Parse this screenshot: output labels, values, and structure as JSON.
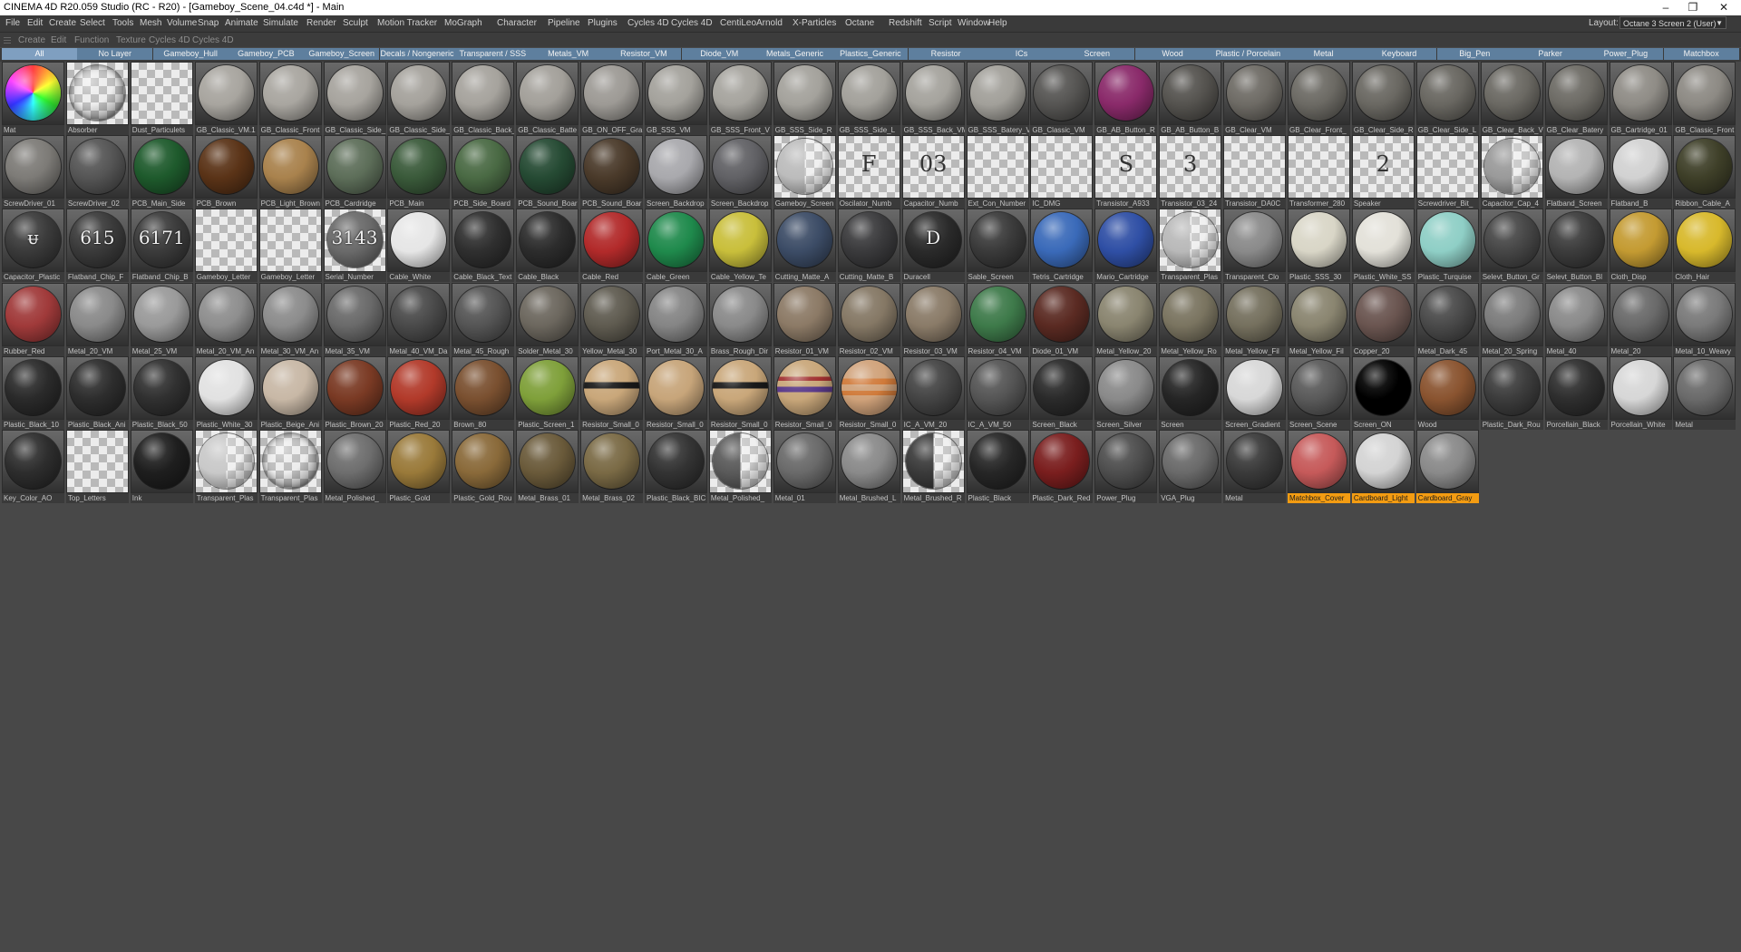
{
  "window": {
    "title": "CINEMA 4D R20.059 Studio (RC - R20) - [Gameboy_Scene_04.c4d *] - Main",
    "minimize_glyph": "–",
    "maximize_glyph": "❐",
    "close_glyph": "✕"
  },
  "menubar": {
    "items": [
      "File",
      "Edit",
      "Create",
      "Select",
      "Tools",
      "Mesh",
      "Volume",
      "Snap",
      "Animate",
      "Simulate",
      "Render",
      "Sculpt",
      "Motion Tracker",
      "MoGraph",
      "Character",
      "Pipeline",
      "Plugins",
      "Cycles 4D",
      "Cycles 4D",
      "CentiLeo",
      "Arnold",
      "X-Particles",
      "Octane",
      "Redshift",
      "Script",
      "Window",
      "Help"
    ],
    "layout_label": "Layout:",
    "layout_value": "Octane 3 Screen 2 (User)"
  },
  "material_menu": {
    "items": [
      "Create",
      "Edit",
      "Function",
      "Texture",
      "Cycles 4D",
      "Cycles 4D"
    ]
  },
  "layer_tabs": [
    "All",
    "No Layer",
    "Gameboy_Hull",
    "Gameboy_PCB",
    "Gameboy_Screen",
    "Decals / Nongeneric",
    "Transparent / SSS",
    "Metals_VM",
    "Resistor_VM",
    "Diode_VM",
    "Metals_Generic",
    "Plastics_Generic",
    "Resistor",
    "ICs",
    "Screen",
    "Wood",
    "Plastic / Porcelain",
    "Metal",
    "Keyboard",
    "Big_Pen",
    "Parker",
    "Power_Plug",
    "Matchbox"
  ],
  "layer_tab_colors": [
    "#7f9fc0",
    "#5e7f9e",
    "#5e7f9e",
    "#5e7f9e",
    "#5e7f9e",
    "#5e7f9e",
    "#5e7f9e",
    "#5e7f9e",
    "#5e7f9e",
    "#5e7f9e",
    "#5e7f9e",
    "#5e7f9e",
    "#5e7f9e",
    "#5e7f9e",
    "#5e7f9e",
    "#5e7f9e",
    "#5e7f9e",
    "#5e7f9e",
    "#5e7f9e",
    "#5e7f9e",
    "#5e7f9e",
    "#5e7f9e",
    "#5e7f9e"
  ],
  "materials": [
    {
      "name": "Mat",
      "bg": "dark",
      "kind": "rainbow"
    },
    {
      "name": "Absorber",
      "bg": "checker",
      "kind": "clear"
    },
    {
      "name": "Dust_Particulets",
      "bg": "checker",
      "kind": "none"
    },
    {
      "name": "GB_Classic_VM.1",
      "bg": "dark",
      "color": "#a8a59f"
    },
    {
      "name": "GB_Classic_Front",
      "bg": "dark",
      "color": "#a9a6a0"
    },
    {
      "name": "GB_Classic_Side_",
      "bg": "dark",
      "color": "#a7a49e"
    },
    {
      "name": "GB_Classic_Side_",
      "bg": "dark",
      "color": "#a5a29c"
    },
    {
      "name": "GB_Classic_Back_",
      "bg": "dark",
      "color": "#a6a39d"
    },
    {
      "name": "GB_Classic_Batte",
      "bg": "dark",
      "color": "#a3a09a"
    },
    {
      "name": "GB_ON_OFF_Gra",
      "bg": "dark",
      "color": "#9d9a95"
    },
    {
      "name": "GB_SSS_VM",
      "bg": "dark",
      "color": "#a4a29c"
    },
    {
      "name": "GB_SSS_Front_V",
      "bg": "dark",
      "color": "#a6a49e"
    },
    {
      "name": "GB_SSS_Side_R",
      "bg": "dark",
      "color": "#a4a29c"
    },
    {
      "name": "GB_SSS_Side_L",
      "bg": "dark",
      "color": "#a3a19b"
    },
    {
      "name": "GB_SSS_Back_VM",
      "bg": "dark",
      "color": "#a5a39d"
    },
    {
      "name": "GB_SSS_Batery_V",
      "bg": "dark",
      "color": "#a2a09a"
    },
    {
      "name": "GB_Classic_VM",
      "bg": "dark",
      "color": "#565553"
    },
    {
      "name": "GB_AB_Button_R",
      "bg": "dark",
      "color": "#8a2a6a"
    },
    {
      "name": "GB_AB_Button_B",
      "bg": "dark",
      "color": "#55534f"
    },
    {
      "name": "GB_Clear_VM",
      "bg": "dark",
      "color": "#6e6b65"
    },
    {
      "name": "GB_Clear_Front_",
      "bg": "dark",
      "color": "#6c6a64"
    },
    {
      "name": "GB_Clear_Side_R",
      "bg": "dark",
      "color": "#6a6862"
    },
    {
      "name": "GB_Clear_Side_L",
      "bg": "dark",
      "color": "#696761"
    },
    {
      "name": "GB_Clear_Back_V",
      "bg": "dark",
      "color": "#6b6963"
    },
    {
      "name": "GB_Clear_Batery",
      "bg": "dark",
      "color": "#6d6b65"
    },
    {
      "name": "GB_Cartridge_01",
      "bg": "dark",
      "color": "#8f8c86"
    },
    {
      "name": "GB_Classic_Front",
      "bg": "dark",
      "color": "#8d8a84"
    },
    {
      "name": "ScrewDriver_01",
      "bg": "dark",
      "color": "#7d7b77"
    },
    {
      "name": "ScrewDriver_02",
      "bg": "dark",
      "color": "#555555"
    },
    {
      "name": "PCB_Main_Side",
      "bg": "dark",
      "color": "#1e5a2c"
    },
    {
      "name": "PCB_Brown",
      "bg": "dark",
      "color": "#5a3317"
    },
    {
      "name": "PCB_Light_Brown",
      "bg": "dark",
      "color": "#a9824d"
    },
    {
      "name": "PCB_Cardridge",
      "bg": "dark",
      "color": "#5d6e59"
    },
    {
      "name": "PCB_Main",
      "bg": "dark",
      "color": "#3a5a3a"
    },
    {
      "name": "PCB_Side_Board",
      "bg": "dark",
      "color": "#4a6a44"
    },
    {
      "name": "PCB_Sound_Boar",
      "bg": "dark",
      "color": "#254a33"
    },
    {
      "name": "PCB_Sound_Boar",
      "bg": "dark",
      "color": "#4a3a2a"
    },
    {
      "name": "Screen_Backdrop",
      "bg": "dark",
      "color": "#a9a9ad"
    },
    {
      "name": "Screen_Backdrop",
      "bg": "dark",
      "color": "#616165"
    },
    {
      "name": "Gameboy_Screen",
      "bg": "checker",
      "color": "#bcbcbc",
      "kind": "half"
    },
    {
      "name": "Oscilator_Numb",
      "bg": "checker",
      "kind": "none",
      "text": "F"
    },
    {
      "name": "Capacitor_Numb",
      "bg": "checker",
      "kind": "none",
      "text": "03"
    },
    {
      "name": "Ext_Con_Number",
      "bg": "checker",
      "kind": "none"
    },
    {
      "name": "IC_DMG",
      "bg": "checker",
      "kind": "none"
    },
    {
      "name": "Transistor_A933",
      "bg": "checker",
      "kind": "none",
      "text": "S"
    },
    {
      "name": "Transistor_03_24",
      "bg": "checker",
      "kind": "none",
      "text": "3"
    },
    {
      "name": "Transistor_DA0C",
      "bg": "checker",
      "kind": "none"
    },
    {
      "name": "Transformer_280",
      "bg": "checker",
      "kind": "none"
    },
    {
      "name": "Speaker",
      "bg": "checker",
      "kind": "none",
      "text": "2"
    },
    {
      "name": "Screwdriver_Bit_",
      "bg": "checker",
      "kind": "none"
    },
    {
      "name": "Capacitor_Cap_4",
      "bg": "checker",
      "color": "#9a9a9a",
      "kind": "half"
    },
    {
      "name": "Flatband_Screen",
      "bg": "dark",
      "color": "#b4b4b4"
    },
    {
      "name": "Flatband_B",
      "bg": "dark",
      "color": "#d2d2d2"
    },
    {
      "name": "Ribbon_Cable_A",
      "bg": "dark",
      "color": "#3e3f28"
    },
    {
      "name": "Capacitor_Plastic",
      "bg": "dark",
      "color": "#3a3a3a",
      "text": "ᵾ"
    },
    {
      "name": "Flatband_Chip_F",
      "bg": "dark",
      "color": "#3a3a3a",
      "text": "615"
    },
    {
      "name": "Flatband_Chip_B",
      "bg": "dark",
      "color": "#3b3b3b",
      "text": "6171"
    },
    {
      "name": "Gameboy_Letter",
      "bg": "checker",
      "kind": "none"
    },
    {
      "name": "Gameboy_Letter",
      "bg": "checker",
      "kind": "none"
    },
    {
      "name": "Serial_Number",
      "bg": "checker",
      "color": "#6a6a6a",
      "text": "3143"
    },
    {
      "name": "Cable_White",
      "bg": "dark",
      "color": "#e6e6e6"
    },
    {
      "name": "Cable_Black_Text",
      "bg": "dark",
      "color": "#2f2f2f"
    },
    {
      "name": "Cable_Black",
      "bg": "dark",
      "color": "#2c2c2c"
    },
    {
      "name": "Cable_Red",
      "bg": "dark",
      "color": "#b22a2a"
    },
    {
      "name": "Cable_Green",
      "bg": "dark",
      "color": "#1f8a4c"
    },
    {
      "name": "Cable_Yellow_Te",
      "bg": "dark",
      "color": "#c9bf3b"
    },
    {
      "name": "Cutting_Matte_A",
      "bg": "dark",
      "color": "#3c4c66"
    },
    {
      "name": "Cutting_Matte_B",
      "bg": "dark",
      "color": "#3a3a3c"
    },
    {
      "name": "Duracell",
      "bg": "dark",
      "color": "#2a2a2a",
      "text": "D"
    },
    {
      "name": "Sable_Screen",
      "bg": "dark",
      "color": "#3a3a3a"
    },
    {
      "name": "Tetris_Cartridge",
      "bg": "dark",
      "color": "#3a6ab9"
    },
    {
      "name": "Mario_Cartridge",
      "bg": "dark",
      "color": "#2f4fa5"
    },
    {
      "name": "Transparent_Plas",
      "bg": "checker",
      "color": "#b9b9b9",
      "kind": "half"
    },
    {
      "name": "Transparent_Clo",
      "bg": "dark",
      "color": "#8a8a8a"
    },
    {
      "name": "Plastic_SSS_30",
      "bg": "dark",
      "color": "#d9d6c7"
    },
    {
      "name": "Plastic_White_SS",
      "bg": "dark",
      "color": "#e3e1d9"
    },
    {
      "name": "Plastic_Turquise",
      "bg": "dark",
      "color": "#8fcfc6"
    },
    {
      "name": "Selevt_Button_Gr",
      "bg": "dark",
      "color": "#464646"
    },
    {
      "name": "Selevt_Button_Bl",
      "bg": "dark",
      "color": "#3c3c3c"
    },
    {
      "name": "Cloth_Disp",
      "bg": "dark",
      "color": "#c49b32"
    },
    {
      "name": "Cloth_Hair",
      "bg": "dark",
      "color": "#d8b92c"
    },
    {
      "name": "Rubber_Red",
      "bg": "dark",
      "color": "#a03a3a"
    },
    {
      "name": "Metal_20_VM",
      "bg": "dark",
      "color": "#8a8a8a"
    },
    {
      "name": "Metal_25_VM",
      "bg": "dark",
      "color": "#9a9a9a"
    },
    {
      "name": "Metal_20_VM_An",
      "bg": "dark",
      "color": "#8e8e8e"
    },
    {
      "name": "Metal_30_VM_An",
      "bg": "dark",
      "color": "#8c8c8c"
    },
    {
      "name": "Metal_35_VM",
      "bg": "dark",
      "color": "#6a6a6a"
    },
    {
      "name": "Metal_40_VM_Da",
      "bg": "dark",
      "color": "#4a4a4a"
    },
    {
      "name": "Metal_45_Rough",
      "bg": "dark",
      "color": "#555555"
    },
    {
      "name": "Solder_Metal_30",
      "bg": "dark",
      "color": "#6c675e"
    },
    {
      "name": "Yellow_Metal_30",
      "bg": "dark",
      "color": "#5f5b50"
    },
    {
      "name": "Port_Metal_30_A",
      "bg": "dark",
      "color": "#858585"
    },
    {
      "name": "Brass_Rough_Dir",
      "bg": "dark",
      "color": "#8a8a8a"
    },
    {
      "name": "Resistor_01_VM",
      "bg": "dark",
      "color": "#8c7a66"
    },
    {
      "name": "Resistor_02_VM",
      "bg": "dark",
      "color": "#857865"
    },
    {
      "name": "Resistor_03_VM",
      "bg": "dark",
      "color": "#8a7b68"
    },
    {
      "name": "Resistor_04_VM",
      "bg": "dark",
      "color": "#3e7a4a"
    },
    {
      "name": "Diode_01_VM",
      "bg": "dark",
      "color": "#5a2a22"
    },
    {
      "name": "Metal_Yellow_20",
      "bg": "dark",
      "color": "#8a8570"
    },
    {
      "name": "Metal_Yellow_Ro",
      "bg": "dark",
      "color": "#7a7460"
    },
    {
      "name": "Metal_Yellow_Fil",
      "bg": "dark",
      "color": "#75705e"
    },
    {
      "name": "Metal_Yellow_Fil",
      "bg": "dark",
      "color": "#8a8570"
    },
    {
      "name": "Copper_20",
      "bg": "dark",
      "color": "#6a5550"
    },
    {
      "name": "Metal_Dark_45",
      "bg": "dark",
      "color": "#4a4a4a"
    },
    {
      "name": "Metal_20_Spring",
      "bg": "dark",
      "color": "#7c7c7c"
    },
    {
      "name": "Metal_40",
      "bg": "dark",
      "color": "#8a8a8a"
    },
    {
      "name": "Metal_20",
      "bg": "dark",
      "color": "#6a6a6a"
    },
    {
      "name": "Metal_10_Weavy",
      "bg": "dark",
      "color": "#7a7a7a"
    },
    {
      "name": "Plastic_Black_10",
      "bg": "dark",
      "color": "#2a2a2a"
    },
    {
      "name": "Plastic_Black_Ani",
      "bg": "dark",
      "color": "#2d2d2d"
    },
    {
      "name": "Plastic_Black_50",
      "bg": "dark",
      "color": "#303030"
    },
    {
      "name": "Plastic_White_30",
      "bg": "dark",
      "color": "#e2e2e2"
    },
    {
      "name": "Plastic_Beige_Ani",
      "bg": "dark",
      "color": "#c8b8a6"
    },
    {
      "name": "Plastic_Brown_20",
      "bg": "dark",
      "color": "#7a3a24"
    },
    {
      "name": "Plastic_Red_20",
      "bg": "dark",
      "color": "#b23a2a"
    },
    {
      "name": "Brown_80",
      "bg": "dark",
      "color": "#7a5030"
    },
    {
      "name": "Plastic_Screen_1",
      "bg": "dark",
      "color": "#7fa03a"
    },
    {
      "name": "Resistor_Small_0",
      "bg": "dark",
      "color": "#c9a77a",
      "kind": "stripe"
    },
    {
      "name": "Resistor_Small_0",
      "bg": "dark",
      "color": "#c7a57a"
    },
    {
      "name": "Resistor_Small_0",
      "bg": "dark",
      "color": "#c9a77a",
      "kind": "stripe"
    },
    {
      "name": "Resistor_Small_0",
      "bg": "dark",
      "color": "#c9a77a",
      "kind": "stripe2"
    },
    {
      "name": "Resistor_Small_0",
      "bg": "dark",
      "color": "#d0a27a",
      "kind": "stripe3"
    },
    {
      "name": "IC_A_VM_20",
      "bg": "dark",
      "color": "#444444"
    },
    {
      "name": "IC_A_VM_50",
      "bg": "dark",
      "color": "#555555"
    },
    {
      "name": "Screen_Black",
      "bg": "dark",
      "color": "#2a2a2a"
    },
    {
      "name": "Screen_Silver",
      "bg": "dark",
      "color": "#8a8a8a"
    },
    {
      "name": "Screen",
      "bg": "dark",
      "color": "#252525"
    },
    {
      "name": "Screen_Gradient",
      "bg": "dark",
      "color": "#d8d8d8"
    },
    {
      "name": "Screen_Scene",
      "bg": "dark",
      "color": "#5a5a5a"
    },
    {
      "name": "Screen_ON",
      "bg": "dark",
      "color": "#000000"
    },
    {
      "name": "Wood",
      "bg": "dark",
      "color": "#8a5430"
    },
    {
      "name": "Plastic_Dark_Rou",
      "bg": "dark",
      "color": "#3c3c3c"
    },
    {
      "name": "Porcellain_Black",
      "bg": "dark",
      "color": "#2e2e2e"
    },
    {
      "name": "Porcellain_White",
      "bg": "dark",
      "color": "#d7d7d7"
    },
    {
      "name": "Metal",
      "bg": "dark",
      "color": "#6a6a6a"
    },
    {
      "name": "Key_Color_AO",
      "bg": "dark",
      "color": "#2d2d2d"
    },
    {
      "name": "Top_Letters",
      "bg": "checker",
      "kind": "none"
    },
    {
      "name": "Ink",
      "bg": "dark",
      "color": "#1e1e1e"
    },
    {
      "name": "Transparent_Plas",
      "bg": "checker",
      "color": "#c9c9c9",
      "kind": "half"
    },
    {
      "name": "Transparent_Plas",
      "bg": "checker",
      "kind": "clear"
    },
    {
      "name": "Metal_Polished_",
      "bg": "dark",
      "color": "#6e6e6e"
    },
    {
      "name": "Plastic_Gold",
      "bg": "dark",
      "color": "#9a7a3a"
    },
    {
      "name": "Plastic_Gold_Rou",
      "bg": "dark",
      "color": "#8a6a3a"
    },
    {
      "name": "Metal_Brass_01",
      "bg": "dark",
      "color": "#6a5a3a"
    },
    {
      "name": "Metal_Brass_02",
      "bg": "dark",
      "color": "#7a6a45"
    },
    {
      "name": "Plastic_Black_BIC",
      "bg": "dark",
      "color": "#333333"
    },
    {
      "name": "Metal_Polished_",
      "bg": "checker",
      "color": "#5a5a5a",
      "kind": "half"
    },
    {
      "name": "Metal_01",
      "bg": "dark",
      "color": "#6a6a6a"
    },
    {
      "name": "Metal_Brushed_L",
      "bg": "dark",
      "color": "#8a8a8a"
    },
    {
      "name": "Metal_Brushed_R",
      "bg": "checker",
      "color": "#3a3a3a",
      "kind": "half"
    },
    {
      "name": "Plastic_Black",
      "bg": "dark",
      "color": "#262626"
    },
    {
      "name": "Plastic_Dark_Red",
      "bg": "dark",
      "color": "#7a1e1e"
    },
    {
      "name": "Power_Plug",
      "bg": "dark",
      "color": "#4e4e4e"
    },
    {
      "name": "VGA_Plug",
      "bg": "dark",
      "color": "#6a6a6a"
    },
    {
      "name": "Metal",
      "bg": "dark",
      "color": "#3a3a3a"
    },
    {
      "name": "Matchbox_Cover",
      "bg": "dark",
      "color": "#c65a5a",
      "sel": true
    },
    {
      "name": "Cardboard_Light",
      "bg": "dark",
      "color": "#d4d4d4",
      "sel": true
    },
    {
      "name": "Cardboard_Gray",
      "bg": "dark",
      "color": "#8a8a8a",
      "sel": true
    }
  ]
}
